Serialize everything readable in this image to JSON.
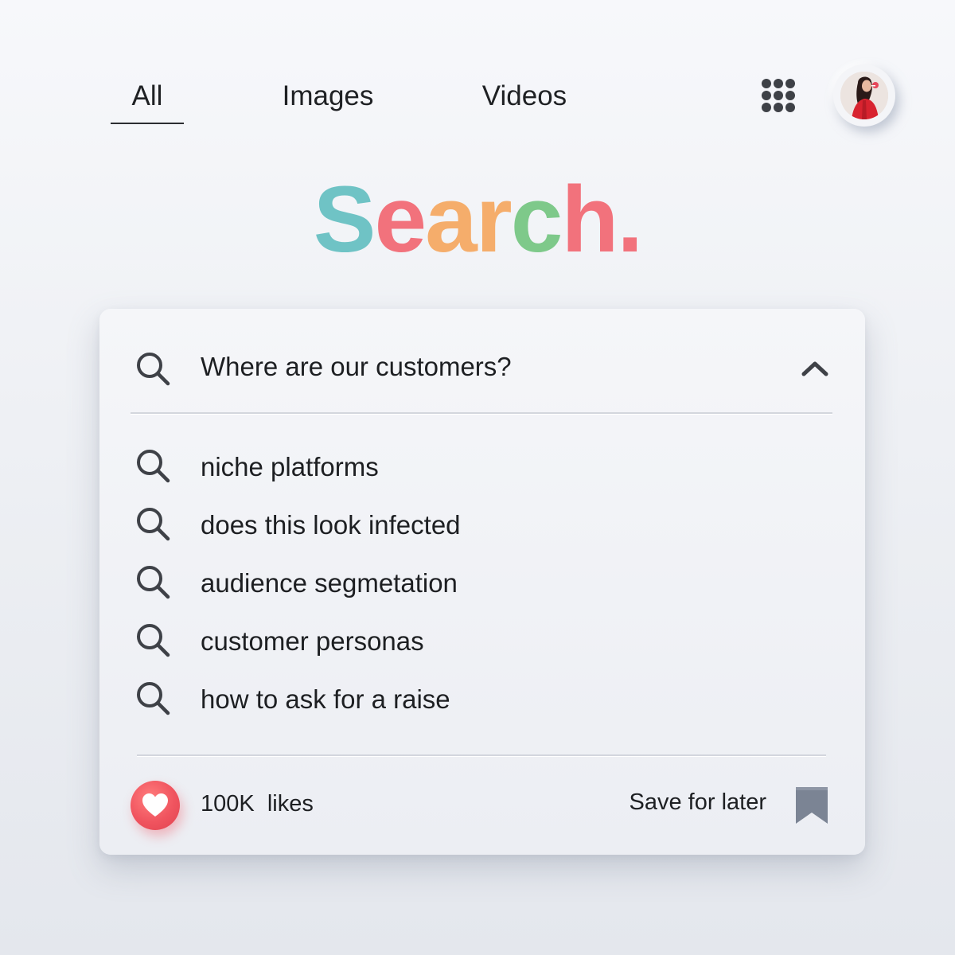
{
  "nav": {
    "tabs": [
      {
        "label": "All",
        "active": true
      },
      {
        "label": "Images",
        "active": false
      },
      {
        "label": "Videos",
        "active": false
      }
    ],
    "apps_icon": "apps-grid-icon",
    "avatar_icon": "user-avatar"
  },
  "logo": {
    "letters": [
      "S",
      "e",
      "a",
      "r",
      "c",
      "h",
      "."
    ],
    "colors": [
      "#6fc3c5",
      "#f2727c",
      "#f5ad6b",
      "#f5ad6b",
      "#7ec98a",
      "#f2727c",
      "#f2727c"
    ]
  },
  "search": {
    "query": "Where are our customers?",
    "search_icon": "search-icon",
    "collapse_icon": "chevron-up-icon",
    "suggestions": [
      {
        "label": "niche platforms"
      },
      {
        "label": "does this look infected"
      },
      {
        "label": "audience segmetation"
      },
      {
        "label": "customer personas"
      },
      {
        "label": "how to ask for a raise"
      }
    ]
  },
  "footer": {
    "like_icon": "heart-icon",
    "likes_count": "100K",
    "likes_label": "likes",
    "save_label": "Save for later",
    "bookmark_icon": "bookmark-icon"
  },
  "colors": {
    "accent_red": "#f0545f",
    "bookmark_gray": "#7b8494",
    "icon_dark": "#3e4147"
  }
}
